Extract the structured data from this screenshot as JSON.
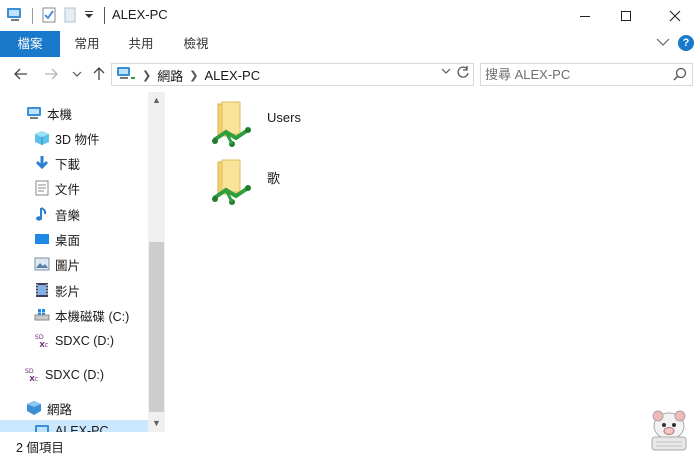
{
  "window": {
    "title": "ALEX-PC",
    "controls": [
      "minimize-icon",
      "maximize-icon",
      "close-icon"
    ]
  },
  "quick_access": [
    "computer-icon",
    "properties-icon",
    "new-folder-icon",
    "customize-dropdown-icon"
  ],
  "ribbon": {
    "tabs": [
      {
        "label": "檔案",
        "active": true
      },
      {
        "label": "常用"
      },
      {
        "label": "共用"
      },
      {
        "label": "檢視"
      }
    ],
    "help_label": "?"
  },
  "nav": {
    "back": "←",
    "forward": "→",
    "recent": "⌄",
    "up": "↑"
  },
  "address": {
    "crumbs": [
      "網路",
      "ALEX-PC"
    ]
  },
  "search": {
    "placeholder": "搜尋 ALEX-PC"
  },
  "sidebar": {
    "items": [
      {
        "label": "本機",
        "icon": "computer-icon"
      },
      {
        "label": "3D 物件",
        "icon": "3d-objects-icon"
      },
      {
        "label": "下載",
        "icon": "downloads-icon"
      },
      {
        "label": "文件",
        "icon": "documents-icon"
      },
      {
        "label": "音樂",
        "icon": "music-icon"
      },
      {
        "label": "桌面",
        "icon": "desktop-icon"
      },
      {
        "label": "圖片",
        "icon": "pictures-icon"
      },
      {
        "label": "影片",
        "icon": "videos-icon"
      },
      {
        "label": "本機磁碟 (C:)",
        "icon": "windows-drive-icon"
      },
      {
        "label": "SDXC (D:)",
        "icon": "sdxc-icon"
      },
      {
        "label": "SDXC (D:)",
        "icon": "sdxc-icon"
      },
      {
        "label": "網路",
        "icon": "network-icon"
      },
      {
        "label": "ALEX-PC",
        "icon": "computer-icon",
        "selected": true
      }
    ]
  },
  "content": {
    "items": [
      {
        "name": "Users",
        "icon": "shared-folder-icon"
      },
      {
        "name": "歌",
        "icon": "shared-folder-icon"
      }
    ]
  },
  "status": {
    "item_count": "2 個項目"
  },
  "colors": {
    "accent": "#1979ca",
    "selection": "#cce8ff",
    "folder": "#f4d06f",
    "share_green": "#2e9e3e"
  }
}
